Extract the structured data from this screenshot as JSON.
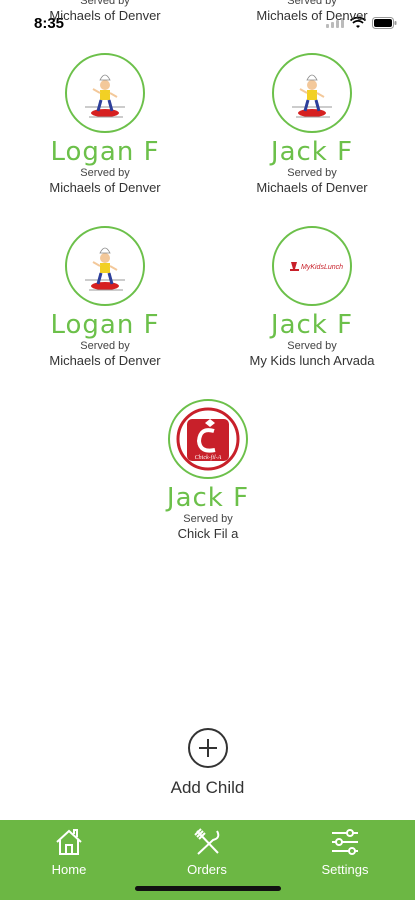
{
  "status": {
    "time": "8:35"
  },
  "served_by_label": "Served by",
  "partial_row": [
    {
      "vendor": "Michaels of Denver"
    },
    {
      "vendor": "Michaels of Denver"
    }
  ],
  "children": [
    {
      "name": "Logan F",
      "vendor": "Michaels of Denver",
      "logo": "chef-icon"
    },
    {
      "name": "Jack F",
      "vendor": "Michaels of Denver",
      "logo": "chef-icon"
    },
    {
      "name": "Logan F",
      "vendor": "Michaels of Denver",
      "logo": "chef-icon"
    },
    {
      "name": "Jack F",
      "vendor": "My Kids lunch Arvada",
      "logo": "mykidslunch-icon",
      "logo_text": "MyKidsLunch"
    },
    {
      "name": "Jack F",
      "vendor": "Chick Fil a",
      "logo": "chickfila-icon",
      "logo_text": "Chick-fil-A"
    }
  ],
  "add_child": {
    "label": "Add Child"
  },
  "tabs": [
    {
      "label": "Home",
      "icon": "home-icon"
    },
    {
      "label": "Orders",
      "icon": "utensils-icon"
    },
    {
      "label": "Settings",
      "icon": "sliders-icon"
    }
  ],
  "colors": {
    "accent": "#6cc04a",
    "tab_bar": "#6cb744"
  }
}
